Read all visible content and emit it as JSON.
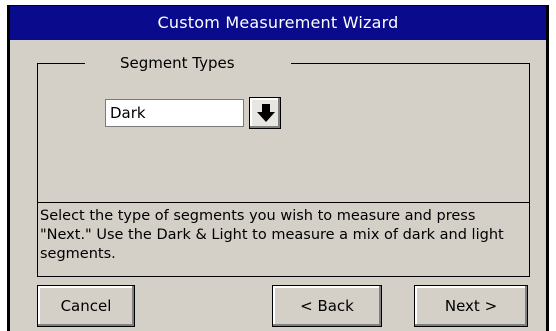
{
  "window": {
    "title": "Custom Measurement Wizard"
  },
  "group": {
    "title": "Segment Types",
    "select_value": "Dark",
    "dropdown_icon": "arrow-down-icon"
  },
  "description": "Select the type of segments you wish to measure and press \"Next.\" Use the Dark & Light to measure a mix of dark and light segments.",
  "buttons": {
    "cancel": "Cancel",
    "back": "< Back",
    "next": "Next >"
  },
  "colors": {
    "titlebar": "#0a0a8c",
    "window_bg": "#d4d0c8"
  }
}
